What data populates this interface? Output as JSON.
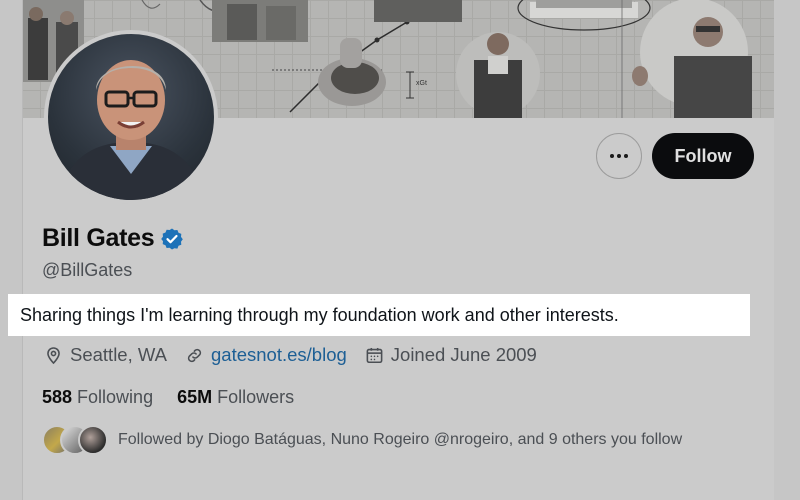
{
  "profile": {
    "display_name": "Bill Gates",
    "handle": "@BillGates",
    "bio": "Sharing things I'm learning through my foundation work and other interests.",
    "location": "Seattle, WA",
    "website": "gatesnot.es/blog",
    "joined": "Joined June 2009",
    "following_count": "588",
    "following_label": "Following",
    "followers_count": "65M",
    "followers_label": "Followers",
    "followed_by": "Followed by Diogo Batáguas, Nuno Rogeiro @nrogeiro, and 9 others you follow"
  },
  "actions": {
    "follow_label": "Follow"
  },
  "banner": {
    "annotation": "xGt"
  },
  "icons": {
    "verified": "verified-badge-icon",
    "location": "location-pin-icon",
    "link": "link-icon",
    "calendar": "calendar-icon",
    "more": "more-options-icon"
  },
  "colors": {
    "link": "#1d5f95",
    "verified": "#1d72b8",
    "follow_button": "#0b0c0e",
    "highlight": "#ffffff"
  }
}
